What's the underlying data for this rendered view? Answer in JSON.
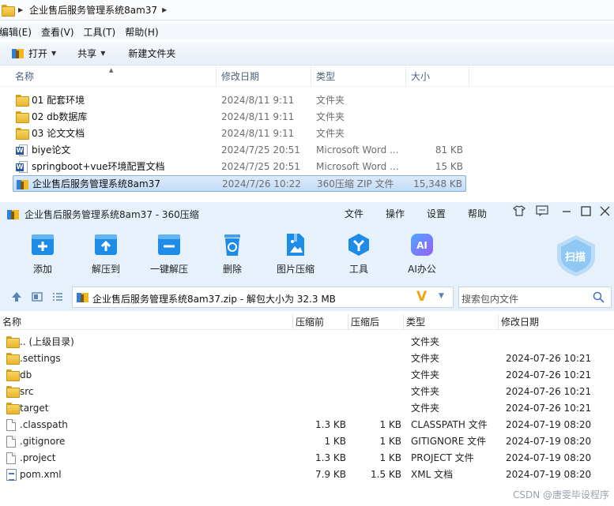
{
  "explorer": {
    "breadcrumb": "企业售后服务管理系统8am37",
    "menu": [
      "编辑(E)",
      "查看(V)",
      "工具(T)",
      "帮助(H)"
    ],
    "toolbar": {
      "open": "打开",
      "share": "共享",
      "new_folder": "新建文件夹"
    },
    "columns": {
      "name": "名称",
      "date": "修改日期",
      "type": "类型",
      "size": "大小"
    },
    "rows": [
      {
        "icon": "folder-icon",
        "name": "01 配套环境",
        "date": "2024/8/11 9:11",
        "type": "文件夹",
        "size": ""
      },
      {
        "icon": "folder-icon",
        "name": "02 db数据库",
        "date": "2024/8/11 9:11",
        "type": "文件夹",
        "size": ""
      },
      {
        "icon": "folder-icon",
        "name": "03 论文文档",
        "date": "2024/8/11 9:11",
        "type": "文件夹",
        "size": ""
      },
      {
        "icon": "word-doc-icon",
        "name": "biye论文",
        "date": "2024/7/25 20:51",
        "type": "Microsoft Word ...",
        "size": "81 KB"
      },
      {
        "icon": "word-doc-icon",
        "name": "springboot+vue环境配置文档",
        "date": "2024/7/25 20:51",
        "type": "Microsoft Word ...",
        "size": "15 KB"
      },
      {
        "icon": "zip-archive-icon",
        "name": "企业售后服务管理系统8am37",
        "date": "2024/7/26 10:22",
        "type": "360压缩 ZIP 文件",
        "size": "15,348 KB",
        "selected": true
      }
    ]
  },
  "zip": {
    "title": "企业售后服务管理系统8am37 - 360压缩",
    "menu": [
      "文件",
      "操作",
      "设置",
      "帮助"
    ],
    "tools": [
      {
        "icon": "add-icon",
        "label": "添加"
      },
      {
        "icon": "extract-to-icon",
        "label": "解压到"
      },
      {
        "icon": "one-click-extract-icon",
        "label": "一键解压"
      },
      {
        "icon": "delete-icon",
        "label": "删除"
      },
      {
        "icon": "image-compress-icon",
        "label": "图片压缩"
      },
      {
        "icon": "tools-icon",
        "label": "工具"
      },
      {
        "icon": "ai-office-icon",
        "label": "AI办公"
      }
    ],
    "scan_label": "扫描",
    "path_text": "企业售后服务管理系统8am37.zip - 解包大小为 32.3 MB",
    "search_placeholder": "搜索包内文件",
    "columns": {
      "name": "名称",
      "csize": "压缩前",
      "psize": "压缩后",
      "type": "类型",
      "date": "修改日期"
    },
    "rows": [
      {
        "icon": "folder-icon",
        "name": ".. (上级目录)",
        "csize": "",
        "psize": "",
        "type": "文件夹",
        "date": ""
      },
      {
        "icon": "folder-icon",
        "name": ".settings",
        "csize": "",
        "psize": "",
        "type": "文件夹",
        "date": "2024-07-26 10:21"
      },
      {
        "icon": "folder-icon",
        "name": "db",
        "csize": "",
        "psize": "",
        "type": "文件夹",
        "date": "2024-07-26 10:21"
      },
      {
        "icon": "folder-icon",
        "name": "src",
        "csize": "",
        "psize": "",
        "type": "文件夹",
        "date": "2024-07-26 10:21"
      },
      {
        "icon": "folder-icon",
        "name": "target",
        "csize": "",
        "psize": "",
        "type": "文件夹",
        "date": "2024-07-26 10:21"
      },
      {
        "icon": "file-icon",
        "name": ".classpath",
        "csize": "1.3 KB",
        "psize": "1 KB",
        "type": "CLASSPATH 文件",
        "date": "2024-07-19 08:20"
      },
      {
        "icon": "file-icon",
        "name": ".gitignore",
        "csize": "1 KB",
        "psize": "1 KB",
        "type": "GITIGNORE 文件",
        "date": "2024-07-19 08:20"
      },
      {
        "icon": "file-icon",
        "name": ".project",
        "csize": "1.3 KB",
        "psize": "1 KB",
        "type": "PROJECT 文件",
        "date": "2024-07-19 08:20"
      },
      {
        "icon": "xml-file-icon",
        "name": "pom.xml",
        "csize": "7.9 KB",
        "psize": "1.5 KB",
        "type": "XML 文档",
        "date": "2024-07-19 08:20"
      }
    ]
  },
  "watermark": "CSDN @唐雯毕设程序"
}
